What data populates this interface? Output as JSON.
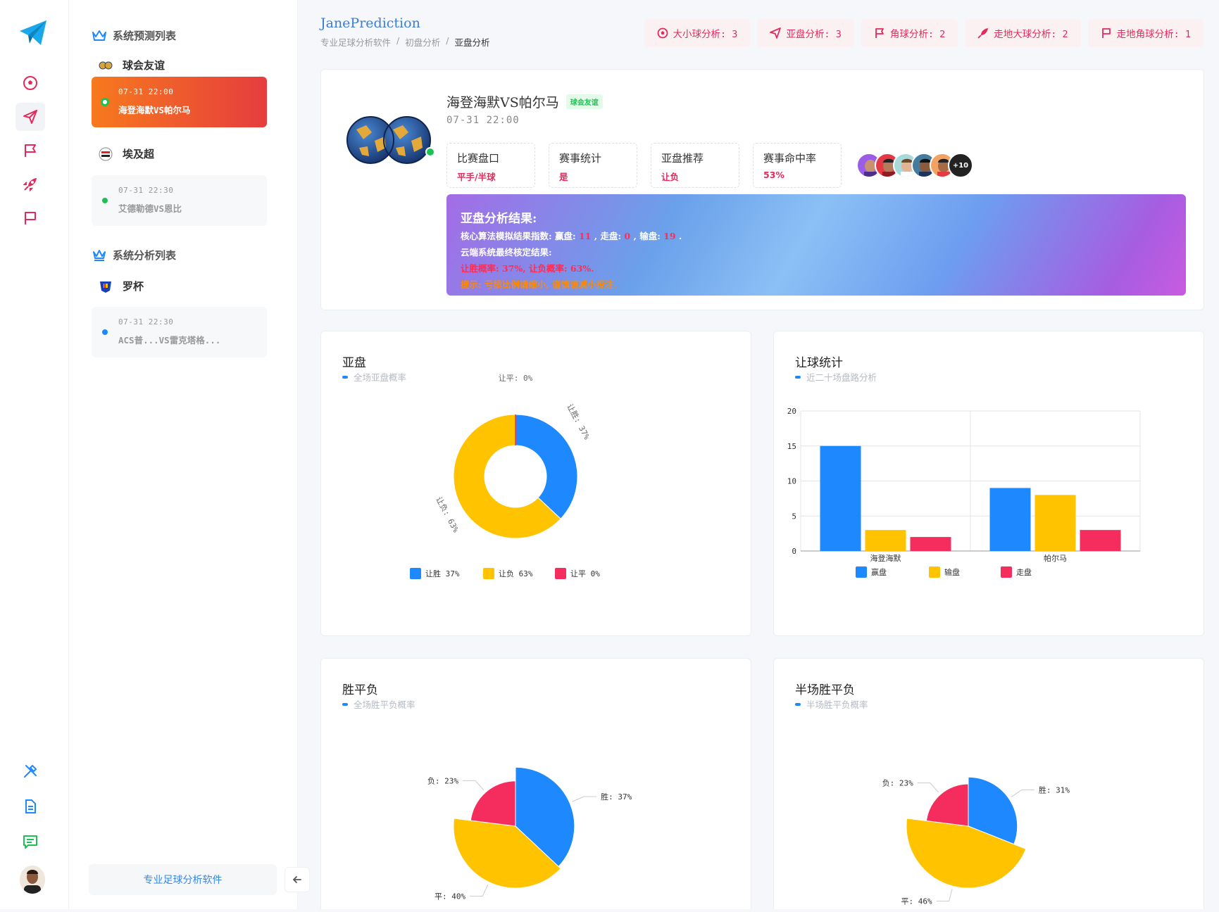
{
  "app": {
    "title": "JanePrediction"
  },
  "breadcrumb": [
    "专业足球分析软件",
    "初盘分析",
    "亚盘分析"
  ],
  "chips": [
    {
      "icon": "soccer-ball-icon",
      "label": "大小球分析: 3"
    },
    {
      "icon": "send-icon",
      "label": "亚盘分析: 3"
    },
    {
      "icon": "flag-icon",
      "label": "角球分析: 2"
    },
    {
      "icon": "rocket-icon",
      "label": "走地大球分析: 2"
    },
    {
      "icon": "flag-icon",
      "label": "走地角球分析: 1"
    }
  ],
  "sidebar": {
    "predict_title": "系统预测列表",
    "analysis_title": "系统分析列表",
    "leagues": [
      {
        "name": "球会友谊"
      },
      {
        "name": "埃及超"
      },
      {
        "name": "罗杯"
      }
    ],
    "matches": [
      {
        "time": "07-31 22:00",
        "name": "海登海默VS帕尔马"
      },
      {
        "time": "07-31 22:30",
        "name": "艾德勒德VS恩比"
      },
      {
        "time": "07-31 22:30",
        "name": "ACS普...VS雷克塔格..."
      }
    ],
    "footer_label": "专业足球分析软件"
  },
  "match": {
    "title": "海登海默VS帕尔马",
    "tag": "球会友谊",
    "time": "07-31 22:00",
    "stats": [
      {
        "label": "比赛盘口",
        "value": "平手/半球"
      },
      {
        "label": "赛事统计",
        "value": "是"
      },
      {
        "label": "亚盘推荐",
        "value": "让负"
      },
      {
        "label": "赛事命中率",
        "value": "53%"
      }
    ],
    "avatar_more": "+10",
    "result": {
      "title": "亚盘分析结果:",
      "line1_prefix": "核心算法模拟结果指数:",
      "win_label": "赢盘:",
      "win_value": "11",
      "draw_label": "走盘:",
      "draw_value": "0",
      "lose_label": "输盘:",
      "lose_value": "19",
      "line2": "云端系统最终核定结果:",
      "line3": "让胜概率: 37%, 让负概率: 63%.",
      "line4": "提示: 亏损比例请缩小, 谨慎请减小投注."
    }
  },
  "charts": {
    "asian": {
      "title": "亚盘",
      "subtitle": "全场亚盘概率"
    },
    "handicap": {
      "title": "让球统计",
      "subtitle": "近二十场盘路分析"
    },
    "wdl": {
      "title": "胜平负",
      "subtitle": "全场胜平负概率"
    },
    "half": {
      "title": "半场胜平负",
      "subtitle": "半场胜平负概率"
    }
  },
  "colors": {
    "blue": "#1e88ff",
    "yellow": "#ffc300",
    "red": "#f42d5e"
  },
  "chart_data": [
    {
      "type": "pie",
      "title": "亚盘",
      "donut": true,
      "categories": [
        "让胜",
        "让负",
        "让平"
      ],
      "values": [
        37,
        63,
        0
      ],
      "labels": [
        "让胜: 37%",
        "让负: 63%",
        "让平: 0%"
      ],
      "legend": [
        "让胜 37%",
        "让负 63%",
        "让平 0%"
      ]
    },
    {
      "type": "bar",
      "title": "让球统计",
      "categories": [
        "海登海默",
        "帕尔马"
      ],
      "series": [
        {
          "name": "赢盘",
          "values": [
            15,
            9
          ]
        },
        {
          "name": "输盘",
          "values": [
            3,
            8
          ]
        },
        {
          "name": "走盘",
          "values": [
            2,
            3
          ]
        }
      ],
      "ylim": [
        0,
        20
      ],
      "yticks": [
        0,
        5,
        10,
        15,
        20
      ]
    },
    {
      "type": "pie",
      "title": "胜平负",
      "rose": true,
      "categories": [
        "胜",
        "平",
        "负"
      ],
      "values": [
        37,
        40,
        23
      ],
      "labels": [
        "胜: 37%",
        "平: 40%",
        "负: 23%"
      ]
    },
    {
      "type": "pie",
      "title": "半场胜平负",
      "rose": true,
      "categories": [
        "胜",
        "平",
        "负"
      ],
      "values": [
        31,
        46,
        23
      ],
      "labels": [
        "胜: 31%",
        "平: 46%",
        "负: 23%"
      ]
    }
  ]
}
